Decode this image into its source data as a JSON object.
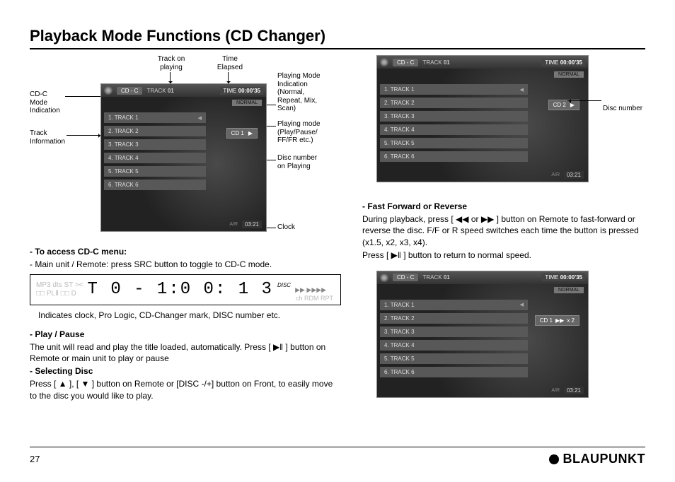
{
  "page": {
    "title": "Playback Mode Functions (CD Changer)",
    "number": "27",
    "brand": "BLAUPUNKT"
  },
  "callouts": {
    "cdc_mode": "CD-C\nMode\nIndication",
    "track_info": "Track\nInformation",
    "track_on_playing": "Track on\nplaying",
    "time_elapsed": "Time\nElapsed",
    "playing_mode": "Playing Mode\nIndication\n(Normal,\nRepeat, Mix,\nScan)",
    "play_state": "Playing mode\n(Play/Pause/\nFF/FR etc.)",
    "disc_playing": "Disc number\non Playing",
    "clock": "Clock",
    "disc_number": "Disc number"
  },
  "screens": {
    "header_mode": "CD - C",
    "track_label_prefix": "TRACK",
    "track_num": "01",
    "time_label": "TIME",
    "time": "00:00'35",
    "normal": "NORMAL",
    "tracks": [
      "1. TRACK 1",
      "2. TRACK 2",
      "3. TRACK 3",
      "4. TRACK 4",
      "5. TRACK 5",
      "6. TRACK 6"
    ],
    "disc1": "CD 1",
    "disc2": "CD 2",
    "ff_speed": "x 2",
    "air": "AIR",
    "clock": "03:21",
    "play_symbol": "▶",
    "ff_symbol": "▶▶"
  },
  "lcd": {
    "faint_icons": [
      "MP3  dts  ST  ><",
      "□□ PLⅡ   □□ D"
    ],
    "digits": "T 0 -  1:0 0: 1 3",
    "disc_label": "DISC",
    "right_faint": "ch  RDM  RPT",
    "speed_icons": "▶▶ ▶▶▶▶"
  },
  "text": {
    "access_head": "- To access CD-C menu:",
    "access_body": "- Main unit / Remote: press SRC button to toggle to CD-C mode.",
    "lcd_caption": "Indicates clock, Pro Logic, CD-Changer mark, DISC number etc.",
    "play_head": "- Play / Pause",
    "play_body": "The unit will read and play the title loaded, automatically.  Press [ ▶‖ ] button on Remote or main unit to play or pause",
    "select_head": "- Selecting Disc",
    "select_body": "Press [ ▲ ], [ ▼ ] button on Remote or [DISC -/+] button on Front, to easily move to the disc you would like to play.",
    "ff_head": "- Fast Forward or Reverse",
    "ff_body1": "During playback, press [ ◀◀  or  ▶▶ ] button on Remote to fast-forward or reverse the disc.  F/F or R speed switches each time the button is pressed (x1.5, x2, x3, x4).",
    "ff_body2": "Press [ ▶‖ ] button to return to normal speed."
  }
}
